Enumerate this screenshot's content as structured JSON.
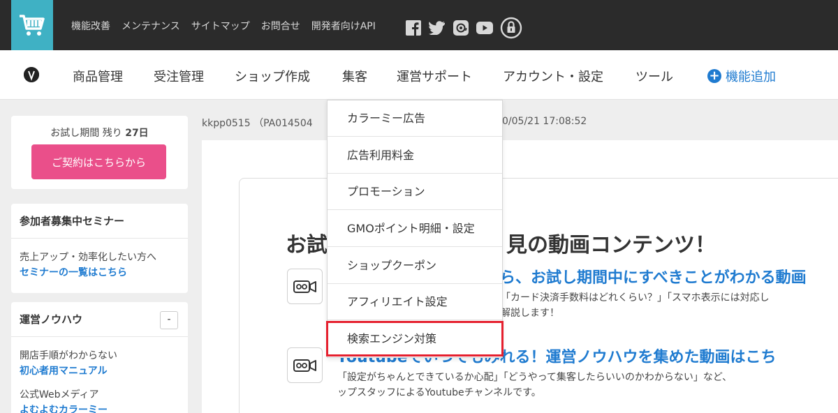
{
  "topbar": {
    "links": [
      "機能改善",
      "メンテナンス",
      "サイトマップ",
      "お問合せ",
      "開発者向けAPI"
    ],
    "social_icons": [
      "facebook-icon",
      "twitter-icon",
      "email-icon",
      "youtube-icon",
      "lock-icon"
    ]
  },
  "nav": {
    "items": [
      "商品管理",
      "受注管理",
      "ショップ作成",
      "集客",
      "運営サポート",
      "アカウント・設定",
      "ツール"
    ],
    "add_feature": "機能追加"
  },
  "dropdown": {
    "items": [
      "カラーミー広告",
      "広告利用料金",
      "プロモーション",
      "GMOポイント明細・設定",
      "ショップクーポン",
      "アフィリエイト設定",
      "検索エンジン対策"
    ],
    "highlighted_index": 6,
    "highlight_color": "#e5202e"
  },
  "sidebar": {
    "trial_prefix": "お試し期間 残り",
    "trial_days": "27日",
    "contract_button": "ご契約はこちらから",
    "seminar_title": "参加者募集中セミナー",
    "seminar_text": "売上アップ・効率化したい方へ",
    "seminar_link": "セミナーの一覧はこちら",
    "knowhow_title": "運営ノウハウ",
    "knowhow_toggle": "-",
    "knowhow_text1": "開店手順がわからない",
    "knowhow_link1": "初心者用マニュアル",
    "knowhow_text2": "公式Webメディア",
    "knowhow_link2": "よむよむカラーミー"
  },
  "content": {
    "account_id": "kkpp0515 （PA014504",
    "timestamp": "0/05/21 17:08:52",
    "headline_left": "お試",
    "headline_right": "見の動画コンテンツ！",
    "section1_title": "ら、お試し期間中にすべきことがわかる動画",
    "section1_text1": "「カード決済手数料はどれくらい？」「スマホ表示には対応し",
    "section1_text2": "解説します！",
    "section2_title": "Youtubeでいつでもみれる！運営ノウハウを集めた動画はこち",
    "section2_text1": "「設定がちゃんとできているか心配」「どうやって集客したらいいのかわからない」など、",
    "section2_text2": "ップスタッフによるYoutubeチャンネルです。"
  },
  "colors": {
    "topbar_bg": "#2b2b2b",
    "cart_logo_bg": "#3fb1c4",
    "accent_blue": "#1f7bd0",
    "contract_pink": "#ea4f8a"
  }
}
